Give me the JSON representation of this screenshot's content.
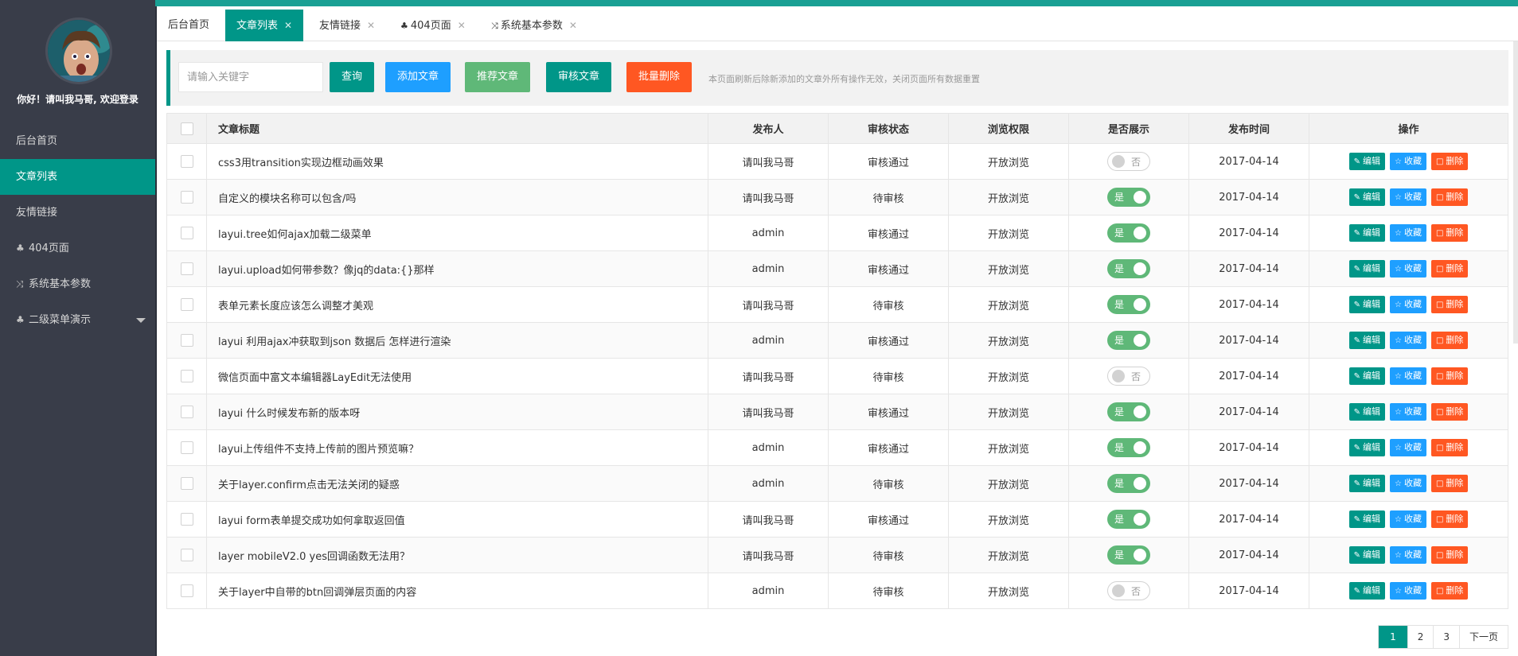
{
  "colors": {
    "accent": "#009688",
    "blue": "#1e9fff",
    "green": "#5fb878",
    "orange": "#ff5722",
    "sidebar": "#393d49",
    "pending": "#ee0000"
  },
  "sidebar": {
    "welcome": "你好！请叫我马哥, 欢迎登录",
    "avatar_icon": "user-avatar",
    "items": [
      {
        "label": "后台首页",
        "icon": ""
      },
      {
        "label": "文章列表",
        "icon": "",
        "active": true
      },
      {
        "label": "友情链接",
        "icon": ""
      },
      {
        "label": "404页面",
        "icon": "github-icon"
      },
      {
        "label": "系统基本参数",
        "icon": "shuffle-icon"
      },
      {
        "label": "二级菜单演示",
        "icon": "github-icon",
        "expandable": true
      }
    ]
  },
  "tabs": [
    {
      "label": "后台首页",
      "closable": false
    },
    {
      "label": "文章列表",
      "closable": true,
      "active": true
    },
    {
      "label": "友情链接",
      "closable": true
    },
    {
      "label": "404页面",
      "closable": true,
      "icon": "github-icon"
    },
    {
      "label": "系统基本参数",
      "closable": true,
      "icon": "shuffle-icon"
    }
  ],
  "toolbar": {
    "search_placeholder": "请输入关键字",
    "query": "查询",
    "add": "添加文章",
    "recommend": "推荐文章",
    "audit": "审核文章",
    "batch_delete": "批量删除",
    "hint": "本页面刷新后除新添加的文章外所有操作无效，关闭页面所有数据重置"
  },
  "table": {
    "headers": {
      "title": "文章标题",
      "author": "发布人",
      "status": "审核状态",
      "permission": "浏览权限",
      "show": "是否展示",
      "time": "发布时间",
      "ops": "操作"
    },
    "switch_on": "是",
    "switch_off": "否",
    "op_edit": "编辑",
    "op_fav": "收藏",
    "op_del": "删除",
    "rows": [
      {
        "title": "css3用transition实现边框动画效果",
        "author": "请叫我马哥",
        "status": "审核通过",
        "permission": "开放浏览",
        "show": false,
        "time": "2017-04-14"
      },
      {
        "title": "自定义的模块名称可以包含/吗",
        "author": "请叫我马哥",
        "status": "待审核",
        "permission": "开放浏览",
        "show": true,
        "time": "2017-04-14"
      },
      {
        "title": "layui.tree如何ajax加载二级菜单",
        "author": "admin",
        "status": "审核通过",
        "permission": "开放浏览",
        "show": true,
        "time": "2017-04-14"
      },
      {
        "title": "layui.upload如何带参数？像jq的data:{}那样",
        "author": "admin",
        "status": "审核通过",
        "permission": "开放浏览",
        "show": true,
        "time": "2017-04-14"
      },
      {
        "title": "表单元素长度应该怎么调整才美观",
        "author": "请叫我马哥",
        "status": "待审核",
        "permission": "开放浏览",
        "show": true,
        "time": "2017-04-14"
      },
      {
        "title": "layui 利用ajax冲获取到json 数据后 怎样进行渲染",
        "author": "admin",
        "status": "审核通过",
        "permission": "开放浏览",
        "show": true,
        "time": "2017-04-14"
      },
      {
        "title": "微信页面中富文本编辑器LayEdit无法使用",
        "author": "请叫我马哥",
        "status": "待审核",
        "permission": "开放浏览",
        "show": false,
        "time": "2017-04-14"
      },
      {
        "title": "layui 什么时候发布新的版本呀",
        "author": "请叫我马哥",
        "status": "审核通过",
        "permission": "开放浏览",
        "show": true,
        "time": "2017-04-14"
      },
      {
        "title": "layui上传组件不支持上传前的图片预览嘛？",
        "author": "admin",
        "status": "审核通过",
        "permission": "开放浏览",
        "show": true,
        "time": "2017-04-14"
      },
      {
        "title": "关于layer.confirm点击无法关闭的疑惑",
        "author": "admin",
        "status": "待审核",
        "permission": "开放浏览",
        "show": true,
        "time": "2017-04-14"
      },
      {
        "title": "layui form表单提交成功如何拿取返回值",
        "author": "请叫我马哥",
        "status": "审核通过",
        "permission": "开放浏览",
        "show": true,
        "time": "2017-04-14"
      },
      {
        "title": "layer mobileV2.0 yes回调函数无法用？",
        "author": "请叫我马哥",
        "status": "待审核",
        "permission": "开放浏览",
        "show": true,
        "time": "2017-04-14"
      },
      {
        "title": "关于layer中自带的btn回调弹层页面的内容",
        "author": "admin",
        "status": "待审核",
        "permission": "开放浏览",
        "show": false,
        "time": "2017-04-14"
      }
    ]
  },
  "pagination": {
    "pages": [
      "1",
      "2",
      "3"
    ],
    "current": "1",
    "next": "下一页"
  }
}
